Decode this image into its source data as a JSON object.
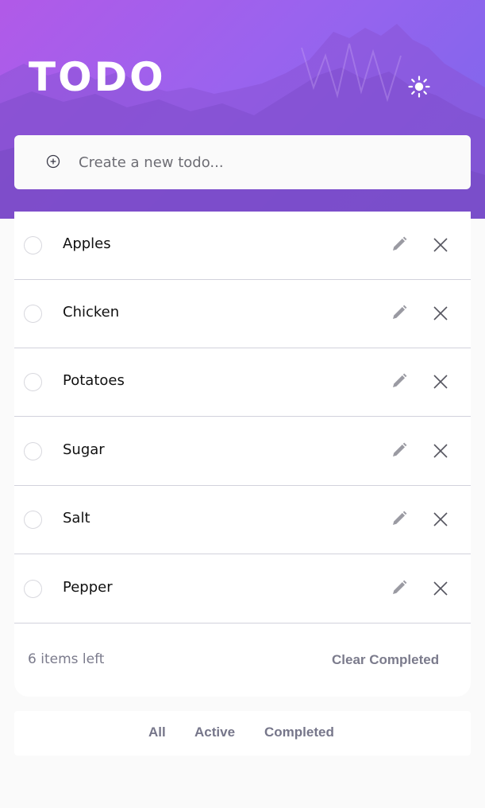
{
  "header": {
    "title": "TODO",
    "theme_toggle_icon": "sun-icon"
  },
  "new_todo": {
    "placeholder": "Create a new todo...",
    "value": "",
    "icon": "plus-circle-icon"
  },
  "todos": [
    {
      "label": "Apples",
      "completed": false
    },
    {
      "label": "Chicken",
      "completed": false
    },
    {
      "label": "Potatoes",
      "completed": false
    },
    {
      "label": "Sugar",
      "completed": false
    },
    {
      "label": "Salt",
      "completed": false
    },
    {
      "label": "Pepper",
      "completed": false
    }
  ],
  "row_icons": {
    "edit": "pencil-icon",
    "delete": "close-icon"
  },
  "footer": {
    "items_left": "6 items left",
    "clear_completed": "Clear Completed"
  },
  "filters": {
    "all": "All",
    "active": "Active",
    "completed": "Completed"
  },
  "colors": {
    "accent_start": "#b15ae8",
    "accent_end": "#7a67ec",
    "muted_text": "#7b7b8c",
    "divider": "#d2d2dc"
  }
}
